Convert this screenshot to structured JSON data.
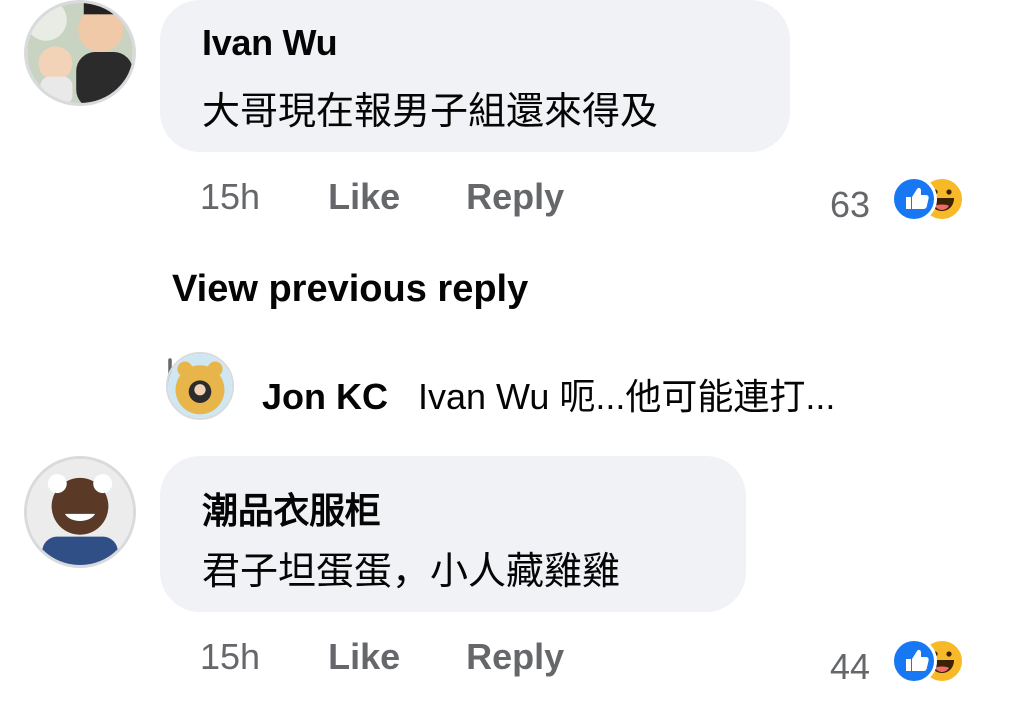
{
  "comments": [
    {
      "author": "Ivan Wu",
      "text": "大哥現在報男子組還來得及",
      "time": "15h",
      "like_label": "Like",
      "reply_label": "Reply",
      "reaction_count": "63",
      "reactions": [
        "like-icon",
        "haha-icon"
      ]
    },
    {
      "author": "潮品衣服柜",
      "text": "君子坦蛋蛋，小人藏雞雞",
      "time": "15h",
      "like_label": "Like",
      "reply_label": "Reply",
      "reaction_count": "44",
      "reactions": [
        "like-icon",
        "haha-icon"
      ]
    }
  ],
  "view_previous_label": "View previous reply",
  "reply_preview": {
    "author": "Jon KC",
    "text": "Ivan Wu 呃...他可能連打..."
  },
  "colors": {
    "bubble": "#f0f2f5",
    "secondary_text": "#65676b",
    "like_blue": "#1877f2",
    "haha_yellow": "#f7b928"
  }
}
